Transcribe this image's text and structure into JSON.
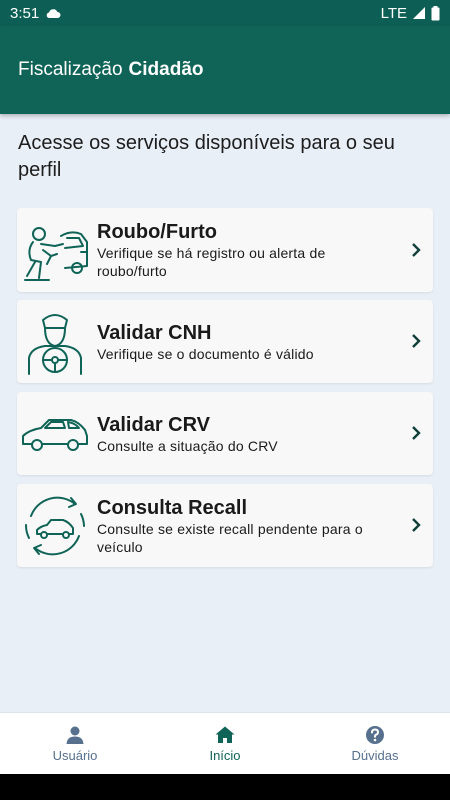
{
  "status_bar": {
    "time": "3:51",
    "network": "LTE"
  },
  "app_bar": {
    "title_regular": "Fiscalização",
    "title_bold": "Cidadão"
  },
  "headline": "Acesse os serviços disponíveis para o seu perfil",
  "services": [
    {
      "title": "Roubo/Furto",
      "description": "Verifique se há registro ou alerta de roubo/furto",
      "icon": "robbery-icon"
    },
    {
      "title": "Validar CNH",
      "description": "Verifique se o documento é válido",
      "icon": "driver-icon"
    },
    {
      "title": "Validar CRV",
      "description": "Consulte a situação do CRV",
      "icon": "car-icon"
    },
    {
      "title": "Consulta Recall",
      "description": "Consulte se existe recall pendente para o veículo",
      "icon": "recall-icon"
    }
  ],
  "bottom_nav": {
    "items": [
      {
        "label": "Usuário",
        "icon": "user-icon"
      },
      {
        "label": "Início",
        "icon": "home-icon"
      },
      {
        "label": "Dúvidas",
        "icon": "help-icon"
      }
    ],
    "active": "Início"
  },
  "colors": {
    "primary": "#0f6457",
    "background": "#e9eff7",
    "card": "#f8f8f8",
    "nav_muted": "#56708e"
  }
}
